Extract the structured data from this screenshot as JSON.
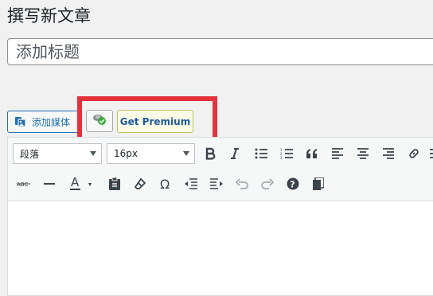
{
  "page": {
    "title": "撰写新文章"
  },
  "title_field": {
    "placeholder": "添加标题",
    "value": ""
  },
  "media": {
    "add_media_label": "添加媒体"
  },
  "plugin": {
    "premium_label": "Get Premium"
  },
  "toolbar": {
    "format_select": "段落",
    "font_size_select": "16px",
    "row1": [
      "bold",
      "italic",
      "bullet-list",
      "numbered-list",
      "blockquote",
      "align-left",
      "align-center",
      "align-right",
      "link"
    ],
    "row2": [
      "strikethrough",
      "horizontal-line",
      "text-color",
      "paste-as-text",
      "clear-formatting",
      "special-character",
      "outdent",
      "indent",
      "undo",
      "redo",
      "keyboard-shortcuts",
      "copy"
    ]
  },
  "colors": {
    "accent": "#2271b1",
    "highlight_frame": "#e4313b",
    "premium_text": "#1e5b9c",
    "premium_background": "#fcfbe5"
  }
}
